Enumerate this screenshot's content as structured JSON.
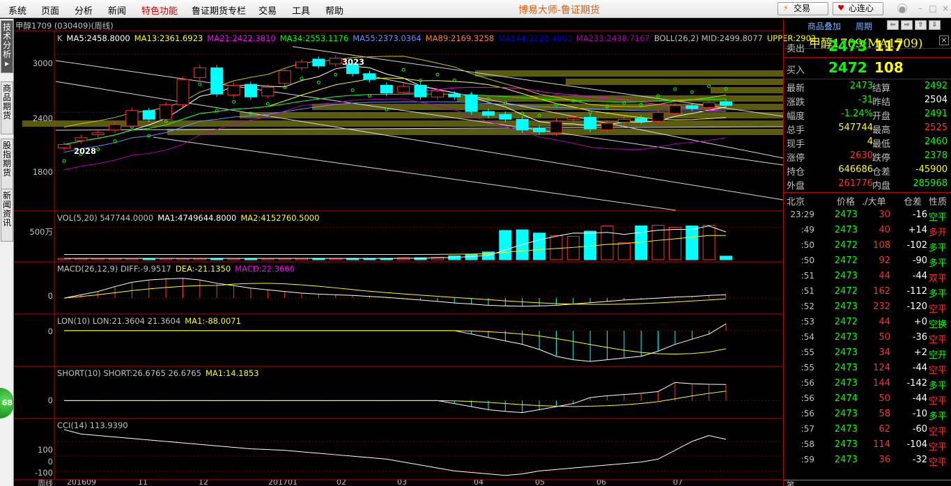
{
  "menu": [
    "系统",
    "页面",
    "分析",
    "新闻",
    "特色功能",
    "鲁证期货专栏",
    "交易",
    "工具",
    "帮助"
  ],
  "app_title": "博易大师-鲁证期货",
  "top_buttons": {
    "trade": "交易",
    "xinlian": "心连心"
  },
  "left_tabs": [
    "技术分析",
    "商品期货",
    "股指期货",
    "新闻资讯"
  ],
  "left_badge": "68",
  "chart": {
    "symbol_title": "甲醇1709 (030409)(周线)",
    "ma_legend": [
      {
        "text": "K",
        "color": "#c0c0c0"
      },
      {
        "text": "MA5:2458.8000",
        "color": "#ffffff"
      },
      {
        "text": "MA13:2361.6923",
        "color": "#ffff00"
      },
      {
        "text": "MA21:2422.3810",
        "color": "#ff00ff"
      },
      {
        "text": "MA34:2553.1176",
        "color": "#00ff00"
      },
      {
        "text": "MA55:2373.0364",
        "color": "#7090ff"
      },
      {
        "text": "MA89:2169.3258",
        "color": "#ff8030"
      },
      {
        "text": "MA144:2221.4861",
        "color": "#0000c8"
      },
      {
        "text": "MA233:2438.7167",
        "color": "#b000b0"
      },
      {
        "text": "BOLL(26,2) MID:2499.8077",
        "color": "#c0c0c0"
      },
      {
        "text": "UPPER:2902",
        "color": "#ffff00"
      }
    ],
    "price_ticks": [
      "3000",
      "2400",
      "1800"
    ],
    "high_label": "3023",
    "low_label": "2028",
    "vol_legend": [
      {
        "text": "VOL(5,20) 547744.0000",
        "color": "#c0c0c0"
      },
      {
        "text": "MA1:4749644.8000",
        "color": "#ffffff"
      },
      {
        "text": "MA2:4152760.5000",
        "color": "#ffff00"
      }
    ],
    "vol_tick": "500万",
    "macd_legend": [
      {
        "text": "MACD(26,12,9) DIFF:-9.9517",
        "color": "#c0c0c0"
      },
      {
        "text": "DEA:-21.1350",
        "color": "#ffff00"
      },
      {
        "text": "MACD:22.3666",
        "color": "#ff00ff"
      }
    ],
    "macd_tick": "0",
    "lon_legend": [
      {
        "text": "LON(10) LON:21.3604 21.3604",
        "color": "#c0c0c0"
      },
      {
        "text": "MA1:-88.0071",
        "color": "#ffff00"
      }
    ],
    "lon_tick": "0",
    "short_legend": [
      {
        "text": "SHORT(10) SHORT:26.6765 26.6765",
        "color": "#c0c0c0"
      },
      {
        "text": "MA1:14.1853",
        "color": "#ffff00"
      }
    ],
    "short_tick": "0",
    "cci_legend": [
      {
        "text": "CCI(14) 113.9390",
        "color": "#c0c0c0"
      }
    ],
    "cci_ticks": [
      "100",
      "0",
      "-100"
    ],
    "x_axis": [
      "周线",
      "201609",
      "11",
      "12",
      "201701",
      "02",
      "03",
      "04",
      "05",
      "06",
      "07"
    ]
  },
  "right_panel": {
    "toolbar": {
      "overlay": "商品叠加",
      "period": "周期"
    },
    "title": "甲醇1709(MA1709)",
    "ask": {
      "label": "卖出",
      "price": "2473",
      "volume": "117"
    },
    "bid": {
      "label": "买入",
      "price": "2472",
      "volume": "108"
    },
    "quote_rows": [
      {
        "l1": "最新",
        "v1": "2473",
        "c1": "#00ff00",
        "l2": "结算",
        "v2": "2492",
        "c2": "#00ff00"
      },
      {
        "l1": "涨跌",
        "v1": "-31",
        "c1": "#00ff00",
        "l2": "昨结",
        "v2": "2504",
        "c2": "#ffffff"
      },
      {
        "l1": "幅度",
        "v1": "-1.24%",
        "c1": "#00ff00",
        "l2": "开盘",
        "v2": "2491",
        "c2": "#00ff00"
      },
      {
        "l1": "总手",
        "v1": "547744",
        "c1": "#ffff00",
        "l2": "最高",
        "v2": "2525",
        "c2": "#ff3030"
      },
      {
        "l1": "现手",
        "v1": "4",
        "c1": "#ffff00",
        "l2": "最低",
        "v2": "2460",
        "c2": "#00ff00"
      },
      {
        "l1": "涨停",
        "v1": "2630",
        "c1": "#ff3030",
        "l2": "跌停",
        "v2": "2378",
        "c2": "#00ff00"
      },
      {
        "l1": "持仓",
        "v1": "646686",
        "c1": "#ffff00",
        "l2": "仓差",
        "v2": "-45900",
        "c2": "#ffff00"
      },
      {
        "l1": "外盘",
        "v1": "261776",
        "c1": "#ff3030",
        "l2": "内盘",
        "v2": "285968",
        "c2": "#00ff00"
      }
    ],
    "tick_header": {
      "place": "北京",
      "price": "价格",
      "big": "./大单",
      "diff": "仓差",
      "nature": "性质"
    },
    "ticks": [
      {
        "time": "23:29",
        "price": "2473",
        "vol": "30",
        "diff": "-16",
        "nature": "空平",
        "nc": "#00ff00"
      },
      {
        "time": ":49",
        "price": "2473",
        "vol": "40",
        "diff": "+14",
        "nature": "多开",
        "nc": "#ff3030"
      },
      {
        "time": ":50",
        "price": "2472",
        "vol": "108",
        "diff": "-102",
        "nature": "多平",
        "nc": "#00ff00"
      },
      {
        "time": ":50",
        "price": "2472",
        "vol": "92",
        "diff": "-90",
        "nature": "多平",
        "nc": "#00ff00"
      },
      {
        "time": ":51",
        "price": "2473",
        "vol": "44",
        "diff": "-44",
        "nature": "双平",
        "nc": "#ff3030"
      },
      {
        "time": ":51",
        "price": "2472",
        "vol": "162",
        "diff": "-112",
        "nature": "多平",
        "nc": "#00ff00"
      },
      {
        "time": ":52",
        "price": "2473",
        "vol": "232",
        "diff": "-120",
        "nature": "空平",
        "nc": "#ff3030"
      },
      {
        "time": ":53",
        "price": "2472",
        "vol": "44",
        "diff": "+0",
        "nature": "空换",
        "nc": "#00ff00"
      },
      {
        "time": ":54",
        "price": "2473",
        "vol": "50",
        "diff": "-36",
        "nature": "空平",
        "nc": "#ff3030"
      },
      {
        "time": ":55",
        "price": "2473",
        "vol": "34",
        "diff": "+2",
        "nature": "空开",
        "nc": "#00ff00"
      },
      {
        "time": ":55",
        "price": "2473",
        "vol": "124",
        "diff": "-44",
        "nature": "空平",
        "nc": "#ff3030"
      },
      {
        "time": ":56",
        "price": "2473",
        "vol": "144",
        "diff": "-142",
        "nature": "多平",
        "nc": "#00ff00"
      },
      {
        "time": ":56",
        "price": "2474",
        "vol": "50",
        "diff": "-44",
        "nature": "空平",
        "nc": "#ff3030"
      },
      {
        "time": ":56",
        "price": "2473",
        "vol": "58",
        "diff": "-10",
        "nature": "多平",
        "nc": "#00ff00"
      },
      {
        "time": ":57",
        "price": "2473",
        "vol": "62",
        "diff": "-60",
        "nature": "空平",
        "nc": "#ff3030"
      },
      {
        "time": ":58",
        "price": "2473",
        "vol": "114",
        "diff": "-104",
        "nature": "空平",
        "nc": "#ff3030"
      },
      {
        "time": ":59",
        "price": "2473",
        "vol": "36",
        "diff": "-32",
        "nature": "空平",
        "nc": "#ff3030"
      }
    ],
    "bottom_label": "笔"
  },
  "chart_data": {
    "type": "candlestick",
    "period": "weekly",
    "ylim": [
      1500,
      3150
    ],
    "candles": [
      {
        "o": 2035,
        "c": 2070
      },
      {
        "o": 2110,
        "c": 2140
      },
      {
        "o": 2170,
        "c": 2190
      },
      {
        "o": 2220,
        "c": 2275
      },
      {
        "o": 2260,
        "c": 2420
      },
      {
        "o": 2420,
        "c": 2330
      },
      {
        "o": 2330,
        "c": 2480
      },
      {
        "o": 2480,
        "c": 2740
      },
      {
        "o": 2760,
        "c": 2860
      },
      {
        "o": 2860,
        "c": 2590
      },
      {
        "o": 2580,
        "c": 2680
      },
      {
        "o": 2690,
        "c": 2560
      },
      {
        "o": 2570,
        "c": 2660
      },
      {
        "o": 2700,
        "c": 2830
      },
      {
        "o": 2860,
        "c": 2920
      },
      {
        "o": 2950,
        "c": 2880
      },
      {
        "o": 2900,
        "c": 2960
      },
      {
        "o": 2900,
        "c": 2800
      },
      {
        "o": 2800,
        "c": 2740
      },
      {
        "o": 2680,
        "c": 2600
      },
      {
        "o": 2610,
        "c": 2670
      },
      {
        "o": 2680,
        "c": 2560
      },
      {
        "o": 2560,
        "c": 2620
      },
      {
        "o": 2590,
        "c": 2560
      },
      {
        "o": 2580,
        "c": 2410
      },
      {
        "o": 2410,
        "c": 2370
      },
      {
        "o": 2380,
        "c": 2330
      },
      {
        "o": 2330,
        "c": 2220
      },
      {
        "o": 2240,
        "c": 2200
      },
      {
        "o": 2190,
        "c": 2310
      },
      {
        "o": 2330,
        "c": 2350
      },
      {
        "o": 2350,
        "c": 2230
      },
      {
        "o": 2220,
        "c": 2290
      },
      {
        "o": 2300,
        "c": 2330
      },
      {
        "o": 2340,
        "c": 2310
      },
      {
        "o": 2310,
        "c": 2400
      },
      {
        "o": 2390,
        "c": 2470
      },
      {
        "o": 2470,
        "c": 2440
      },
      {
        "o": 2450,
        "c": 2500
      },
      {
        "o": 2510,
        "c": 2473
      }
    ],
    "volume": [
      0.2,
      0.2,
      0.2,
      0.2,
      0.2,
      0.2,
      0.2,
      0.2,
      0.2,
      0.2,
      0.2,
      0.2,
      0.2,
      0.2,
      0.2,
      0.2,
      0.2,
      0.2,
      0.2,
      0.2,
      0.3,
      0.3,
      0.4,
      0.6,
      0.8,
      1.2,
      4.5,
      4.6,
      4.1,
      3.7,
      3.6,
      4.4,
      5.2,
      2.6,
      5.2,
      5.3,
      5.0,
      5.2,
      5.3,
      0.55
    ],
    "macd": [
      0,
      10,
      20,
      35,
      48,
      55,
      58,
      60,
      55,
      45,
      38,
      30,
      25,
      20,
      15,
      12,
      10,
      8,
      5,
      2,
      -2,
      -6,
      -10,
      -15,
      -18,
      -22,
      -24,
      -25,
      -24,
      -22,
      -18,
      -14,
      -10,
      -6,
      -3,
      0,
      3,
      5,
      8,
      10
    ],
    "lon": [
      0,
      0,
      0,
      0,
      0,
      0,
      0,
      0,
      0,
      0,
      0,
      0,
      0,
      0,
      0,
      0,
      0,
      0,
      0,
      0,
      0,
      0,
      0,
      0,
      -10,
      -20,
      -30,
      -40,
      -55,
      -75,
      -85,
      -90,
      -85,
      -80,
      -75,
      -60,
      -40,
      -25,
      -10,
      20
    ],
    "short": [
      0,
      0,
      0,
      0,
      0,
      0,
      0,
      0,
      0,
      0,
      0,
      0,
      0,
      0,
      0,
      0,
      0,
      0,
      0,
      0,
      0,
      0,
      0,
      -5,
      -10,
      -15,
      -18,
      -20,
      -15,
      -10,
      -5,
      5,
      8,
      10,
      12,
      15,
      30,
      28,
      27,
      26.7
    ],
    "cci": [
      180,
      150,
      140,
      130,
      120,
      110,
      100,
      90,
      80,
      70,
      60,
      50,
      45,
      40,
      30,
      20,
      10,
      0,
      -10,
      -20,
      -40,
      -60,
      -80,
      -100,
      -110,
      -120,
      -130,
      -120,
      -100,
      -90,
      -80,
      -70,
      -60,
      -50,
      -40,
      -20,
      40,
      100,
      140,
      113.9
    ]
  }
}
